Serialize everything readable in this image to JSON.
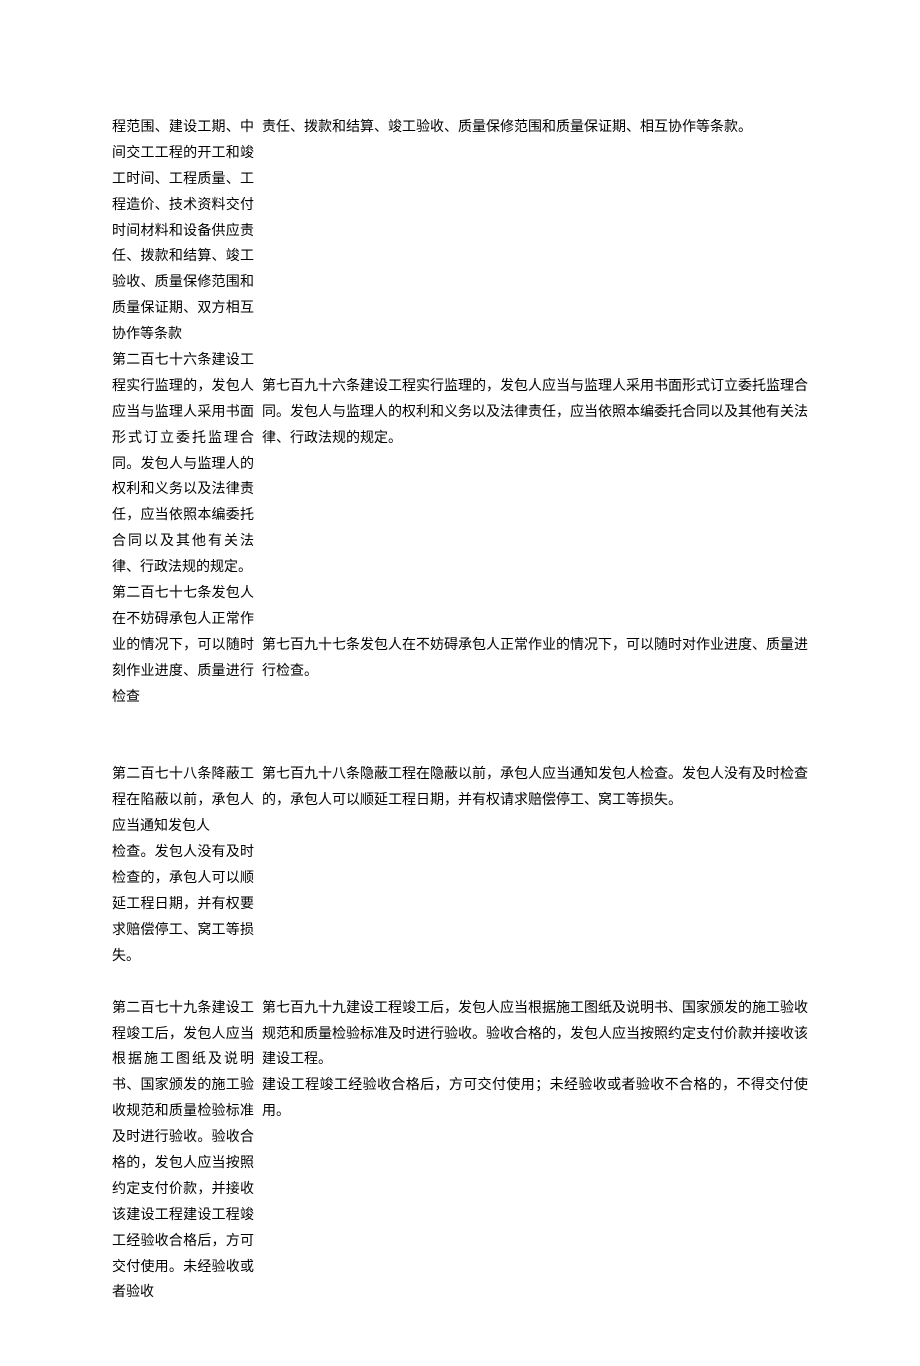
{
  "rows": [
    {
      "left": "程范围、建设工期、中间交工工程的开工和竣工时间、工程质量、工程造价、技术资料交付时间材料和设备供应责任、拨款和结算、竣工验收、质量保修范围和质量保证期、双方相互协作等条款",
      "right": "责任、拨款和结算、竣工验收、质量保修范围和质量保证期、相互协作等条款。"
    },
    {
      "left": "第二百七十六条建设工程实行监理的，发包人应当与监理人采用书面形式订立委托监理合同。发包人与监理人的权利和义务以及法律责任，应当依照本编委托合同以及其他有关法律、行政法规的规定。",
      "right": "第七百九十六条建设工程实行监理的，发包人应当与监理人采用书面形式订立委托监理合同。发包人与监理人的权利和义务以及法律责任，应当依照本编委托合同以及其他有关法律、行政法规的规定。",
      "rightOffset": 1
    },
    {
      "left": "第二百七十七条发包人在不妨碍承包人正常作业的情况下，可以随时刻作业进度、质量进行检查",
      "right": "第七百九十七条发包人在不妨碍承包人正常作业的情况下，可以随时对作业进度、质量进行检查。",
      "rightOffset": 2,
      "spacerAfter": "md"
    },
    {
      "left": "第二百七十八条降蔽工程在陷蔽以前，承包人应当通知发包人",
      "right": "第七百九十八条隐蔽工程在隐蔽以前，承包人应当通知发包人检查。发包人没有及时检查的，承包人可以顺延工程日期，并有权请求赔偿停工、窝工等损失。"
    },
    {
      "left": "检查。发包人没有及时检查的，承包人可以顺延工程日期，并有权要求赔偿停工、窝工等损失。",
      "right": "",
      "spacerAfter": "sm"
    },
    {
      "left": "第二百七十九条建设工程竣工后，发包人应当根据施工图纸及说明书、国家颁发的施工验收规范和质量检验标准及时进行验收。验收合格的，发包人应当按照约定支付价款，并接收该建设工程建设工程竣工经验收合格后，方可交付使用。未经验收或者验收",
      "right": "第七百九十九建设工程竣工后，发包人应当根据施工图纸及说明书、国家颁发的施工验收规范和质量检验标准及时进行验收。验收合格的，发包人应当按照约定支付价款并接收该建设工程。\n建设工程竣工经验收合格后，方可交付使用；未经验收或者验收不合格的，不得交付使用。"
    }
  ]
}
